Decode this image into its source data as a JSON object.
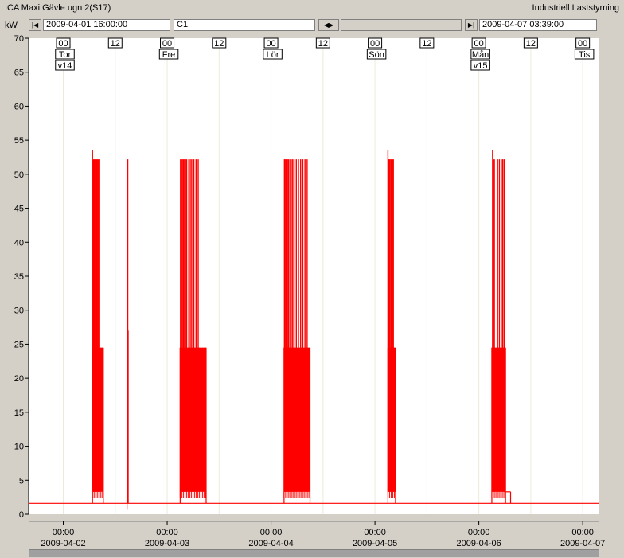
{
  "window": {
    "title": "ICA Maxi Gävle ugn 2(S17)",
    "company": "Industriell Laststyrning"
  },
  "toolbar": {
    "unit": "kW",
    "start_label": "2009-04-01 16:00:00",
    "channel": "C1",
    "end_label": "2009-04-07 03:39:00",
    "first_icon": "skip-back-icon",
    "pan_icon": "scroll-left-right-icon",
    "last_icon": "skip-forward-icon"
  },
  "chart_data": {
    "type": "line",
    "title": "",
    "ylabel": "kW",
    "ylim": [
      0,
      70
    ],
    "yticks": [
      0,
      5,
      10,
      15,
      20,
      25,
      30,
      35,
      40,
      45,
      50,
      55,
      60,
      65,
      70
    ],
    "xlim": [
      "2009-04-01 16:00",
      "2009-04-07 03:39"
    ],
    "grid": true,
    "series_color": "#ff0000",
    "baseline_kw": 1.6,
    "markers": [
      {
        "time": "2009-04-02 00:00",
        "lines": [
          "00",
          "Tor",
          "v14"
        ]
      },
      {
        "time": "2009-04-02 12:00",
        "lines": [
          "12"
        ]
      },
      {
        "time": "2009-04-03 00:00",
        "lines": [
          "00",
          "Fre"
        ]
      },
      {
        "time": "2009-04-03 12:00",
        "lines": [
          "12"
        ]
      },
      {
        "time": "2009-04-04 00:00",
        "lines": [
          "00",
          "Lör"
        ]
      },
      {
        "time": "2009-04-04 12:00",
        "lines": [
          "12"
        ]
      },
      {
        "time": "2009-04-05 00:00",
        "lines": [
          "00",
          "Sön"
        ]
      },
      {
        "time": "2009-04-05 12:00",
        "lines": [
          "12"
        ]
      },
      {
        "time": "2009-04-06 00:00",
        "lines": [
          "00",
          "Mån",
          "v15"
        ]
      },
      {
        "time": "2009-04-06 12:00",
        "lines": [
          "12"
        ]
      },
      {
        "time": "2009-04-07 00:00",
        "lines": [
          "00",
          "Tis"
        ]
      }
    ],
    "xticks": [
      {
        "time": "2009-04-02 00:00",
        "hour": "00:00",
        "date": "2009-04-02"
      },
      {
        "time": "2009-04-03 00:00",
        "hour": "00:00",
        "date": "2009-04-03"
      },
      {
        "time": "2009-04-04 00:00",
        "hour": "00:00",
        "date": "2009-04-04"
      },
      {
        "time": "2009-04-05 00:00",
        "hour": "00:00",
        "date": "2009-04-05"
      },
      {
        "time": "2009-04-06 00:00",
        "hour": "00:00",
        "date": "2009-04-06"
      },
      {
        "time": "2009-04-07 00:00",
        "hour": "00:00",
        "date": "2009-04-07"
      }
    ],
    "series": [
      {
        "blocks": [
          {
            "start": "2009-04-02 06:45",
            "end": "2009-04-02 09:15",
            "low": 3.3,
            "high": 24.5,
            "peak": 53.6,
            "spikes": [
              "2009-04-02 06:45",
              "2009-04-02 06:57",
              "2009-04-02 07:12",
              "2009-04-02 07:24",
              "2009-04-02 07:36",
              "2009-04-02 07:51",
              "2009-04-02 08:03",
              "2009-04-02 08:24"
            ],
            "spike_kw": 52.2
          },
          {
            "start": "2009-04-02 14:45",
            "end": "2009-04-02 15:00",
            "low": 1.6,
            "high": 27.0,
            "peak": 52.2,
            "spikes": [
              "2009-04-02 14:54"
            ],
            "spike_kw": 52.2
          },
          {
            "start": "2009-04-03 03:00",
            "end": "2009-04-03 09:00",
            "low": 3.3,
            "high": 24.5,
            "peak": 52.2,
            "spikes": [
              "2009-04-03 03:05",
              "2009-04-03 03:15",
              "2009-04-03 03:30",
              "2009-04-03 03:45",
              "2009-04-03 04:00",
              "2009-04-03 04:15",
              "2009-04-03 04:30",
              "2009-04-03 05:00",
              "2009-04-03 05:20",
              "2009-04-03 05:40",
              "2009-04-03 06:10",
              "2009-04-03 06:40",
              "2009-04-03 07:10"
            ],
            "spike_kw": 52.2
          },
          {
            "start": "2009-04-04 03:00",
            "end": "2009-04-04 09:00",
            "low": 3.3,
            "high": 24.5,
            "peak": 52.2,
            "spikes": [
              "2009-04-04 03:05",
              "2009-04-04 03:15",
              "2009-04-04 03:30",
              "2009-04-04 03:45",
              "2009-04-04 04:00",
              "2009-04-04 04:20",
              "2009-04-04 04:40",
              "2009-04-04 05:00",
              "2009-04-04 05:20",
              "2009-04-04 05:50",
              "2009-04-04 06:20",
              "2009-04-04 06:50",
              "2009-04-04 07:20",
              "2009-04-04 07:50",
              "2009-04-04 08:20"
            ],
            "spike_kw": 52.2
          },
          {
            "start": "2009-04-05 03:00",
            "end": "2009-04-05 04:45",
            "low": 3.3,
            "high": 24.5,
            "peak": 53.6,
            "spikes": [
              "2009-04-05 03:00",
              "2009-04-05 03:10",
              "2009-04-05 03:20",
              "2009-04-05 03:30",
              "2009-04-05 03:45",
              "2009-04-05 04:00",
              "2009-04-05 04:15"
            ],
            "spike_kw": 52.2
          },
          {
            "start": "2009-04-06 03:00",
            "end": "2009-04-06 06:10",
            "low": 3.3,
            "high": 24.5,
            "peak": 53.6,
            "spikes": [
              "2009-04-06 03:10",
              "2009-04-06 03:20",
              "2009-04-06 03:35",
              "2009-04-06 04:20",
              "2009-04-06 04:45",
              "2009-04-06 05:10",
              "2009-04-06 05:30",
              "2009-04-06 05:50"
            ],
            "spike_kw": 52.2
          }
        ],
        "tail": {
          "start": "2009-04-06 06:10",
          "end": "2009-04-06 07:20",
          "kw": 3.3
        }
      }
    ]
  }
}
